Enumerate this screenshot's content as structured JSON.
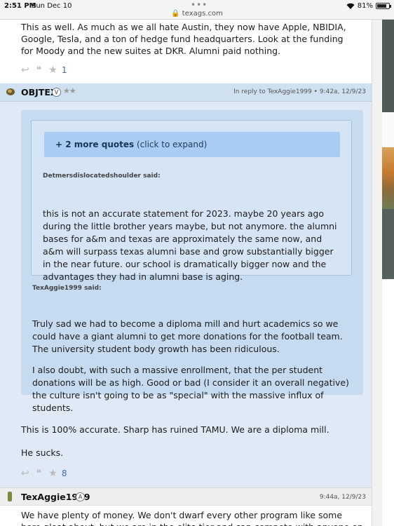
{
  "status_bar": {
    "time": "2:51 PM",
    "date": "Sun Dec 10",
    "url": "texags.com",
    "battery": "81%",
    "battery_level": 0.81
  },
  "previous_post": {
    "text": "This as well. As much as we all hate Austin, they now have Apple, NBIDIA, Google, Tesla, and a ton of hedge fund headquarters. Look at the funding for Moody and the new suites at DKR. Alumni paid nothing.",
    "star_count": "1"
  },
  "post_objtex": {
    "author": "OBJTEX",
    "badge": "V",
    "stars": "★★",
    "reply_meta": "In reply to TexAggie1999 • 9:42a, 12/9/23",
    "expand_quotes_bold": "+ 2 more quotes",
    "expand_quotes_rest": " (click to expand)",
    "inner_quote_author": "Detmersdislocatedshoulder said:",
    "inner_quote_text": "this is not an accurate statement for 2023. maybe 20 years ago during the little brother years maybe, but not anymore. the alumni bases for a&m and texas are approximately the same now, and a&m will surpass texas alumni base and grow substantially bigger in the near future. our school is dramatically bigger now and the advantages they had in alumni base is aging.",
    "outer_quote_author": "TexAggie1999 said:",
    "outer_quote_para1": "Truly sad we had to become a diploma mill and hurt academics so we could have a giant alumni to get more donations for the football team. The university student body growth has been ridiculous.",
    "outer_quote_para2": "I also doubt, with such a massive enrollment, that the per student donations will be as high. Good or bad (I consider it an overall negative) the culture isn't going to be as \"special\" with the massive influx of students.",
    "reply_line1": "This is 100% accurate. Sharp has ruined TAMU. We are a diploma mill.",
    "reply_line2": "He sucks.",
    "star_count": "8"
  },
  "post_texaggie": {
    "author": "TexAggie1999",
    "badge": "A",
    "meta": "9:44a, 12/9/23",
    "text": "We have plenty of money. We don't dwarf every other program like some here gloat about, but we are in the elite tier and can compete with anyone on spending."
  },
  "icons": [
    "wifi-icon",
    "battery-icon",
    "reply-icon",
    "quote-icon",
    "star-icon",
    "avatar-icon"
  ],
  "colors": {
    "post_bg": "#dfeaf6",
    "header_bg": "#cfe0f1",
    "quote_bg": "#c6daf0",
    "expand_bg": "#a9cdf2",
    "link": "#3a6ea5"
  }
}
